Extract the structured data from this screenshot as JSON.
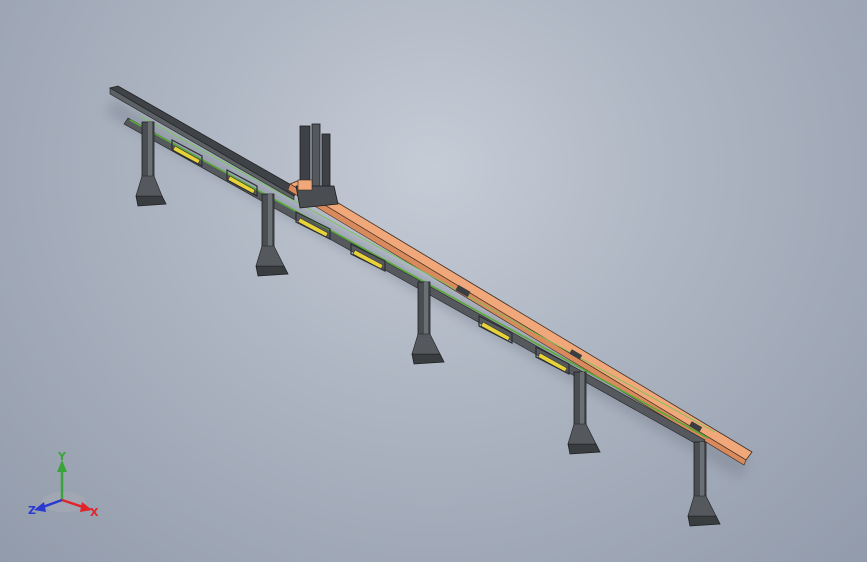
{
  "viewport": {
    "background_top": "#c6ccd6",
    "background_bottom": "#929bab"
  },
  "model": {
    "rail_color": "#f0a87a",
    "structure_color": "#4a4e52",
    "guide_color": "#5aa83a",
    "bracket_color": "#e8d23a",
    "column_count": 5
  },
  "triad": {
    "x_label": "X",
    "y_label": "Y",
    "z_label": "Z",
    "x_color": "#e0242a",
    "y_color": "#3aa43a",
    "z_color": "#2a3ad0"
  }
}
